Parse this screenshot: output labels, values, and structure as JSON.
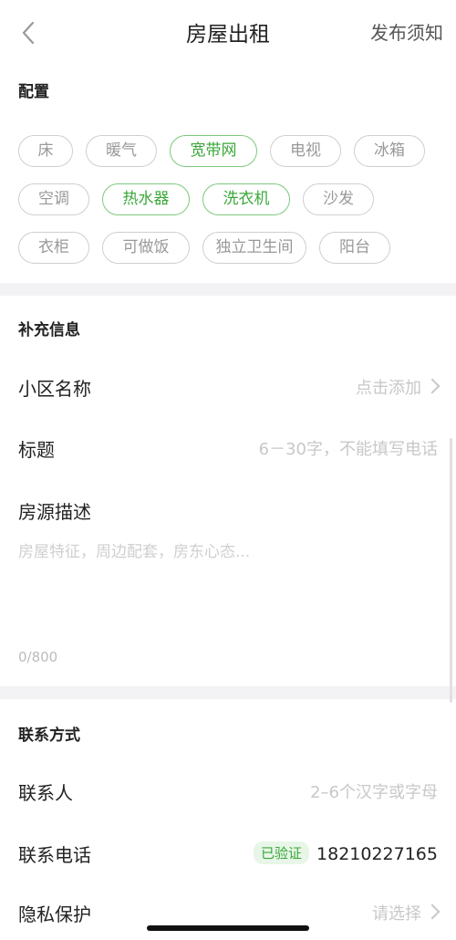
{
  "nav": {
    "title": "房屋出租",
    "right_label": "发布须知"
  },
  "config": {
    "title": "配置",
    "tag_rows": [
      [
        {
          "label": "床",
          "selected": false
        },
        {
          "label": "暖气",
          "selected": false
        },
        {
          "label": "宽带网",
          "selected": true
        },
        {
          "label": "电视",
          "selected": false
        },
        {
          "label": "冰箱",
          "selected": false
        }
      ],
      [
        {
          "label": "空调",
          "selected": false
        },
        {
          "label": "热水器",
          "selected": true
        },
        {
          "label": "洗衣机",
          "selected": true
        },
        {
          "label": "沙发",
          "selected": false
        }
      ],
      [
        {
          "label": "衣柜",
          "selected": false
        },
        {
          "label": "可做饭",
          "selected": false
        },
        {
          "label": "独立卫生间",
          "selected": false
        },
        {
          "label": "阳台",
          "selected": false
        }
      ]
    ]
  },
  "extra": {
    "title": "补充信息",
    "community": {
      "label": "小区名称",
      "placeholder": "点击添加"
    },
    "headline": {
      "label": "标题",
      "placeholder": "6－30字，不能填写电话"
    },
    "description": {
      "label": "房源描述",
      "placeholder": "房屋特征，周边配套，房东心态...",
      "counter": "0/800"
    }
  },
  "contact": {
    "title": "联系方式",
    "person": {
      "label": "联系人",
      "placeholder": "2–6个汉字或字母"
    },
    "phone": {
      "label": "联系电话",
      "badge": "已验证",
      "value": "18210227165"
    },
    "privacy": {
      "label": "隐私保护",
      "placeholder": "请选择"
    }
  },
  "colors": {
    "accent_green": "#3aa83a",
    "divider_gray": "#f3f3f5"
  }
}
